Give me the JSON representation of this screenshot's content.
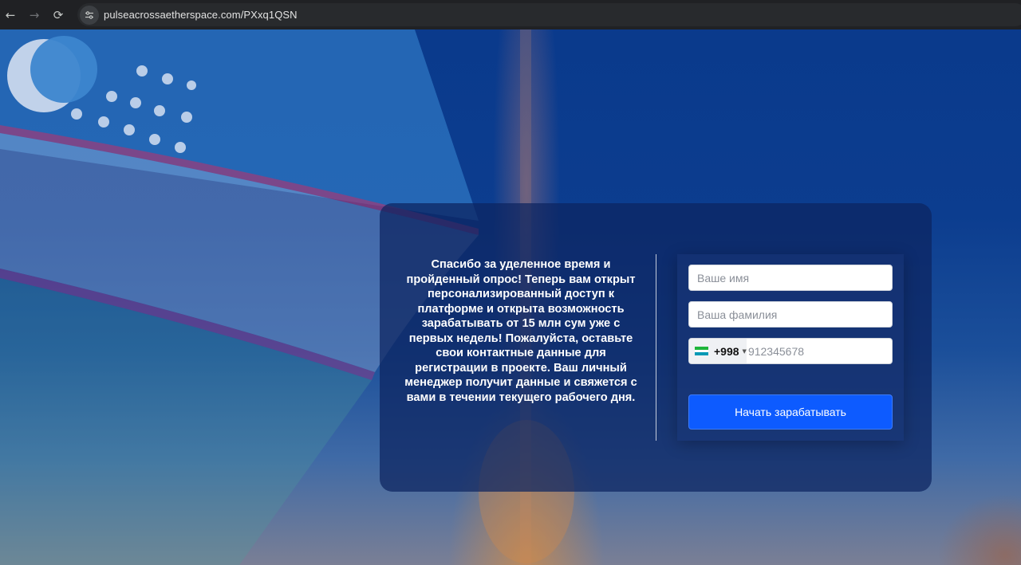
{
  "browser": {
    "url": "pulseacrossaetherspace.com/PXxq1QSN",
    "back_icon": "arrow-left-icon",
    "forward_icon": "arrow-right-icon",
    "reload_icon": "reload-icon",
    "site_info_icon": "tune-icon"
  },
  "card": {
    "message": "Спасибо за уделенное время и пройденный опрос! Теперь вам открыт персонализированный доступ к платформе и открыта возможность зарабатывать от 15 млн сум уже с первых недель! Пожалуйста, оставьте свои контактные данные для регистрации в проекте. Ваш личный менеджер получит данные и свяжется с вами в течении текущего рабочего дня."
  },
  "form": {
    "first_name_placeholder": "Ваше имя",
    "last_name_placeholder": "Ваша фамилия",
    "phone": {
      "dial_code": "+998",
      "placeholder": "912345678",
      "flag_colors": [
        "#1eb53a",
        "#ffffff",
        "#0099b5"
      ]
    },
    "submit_label": "Начать зарабатывать"
  },
  "colors": {
    "button": "#0d5bff",
    "card": "#0c2460"
  }
}
